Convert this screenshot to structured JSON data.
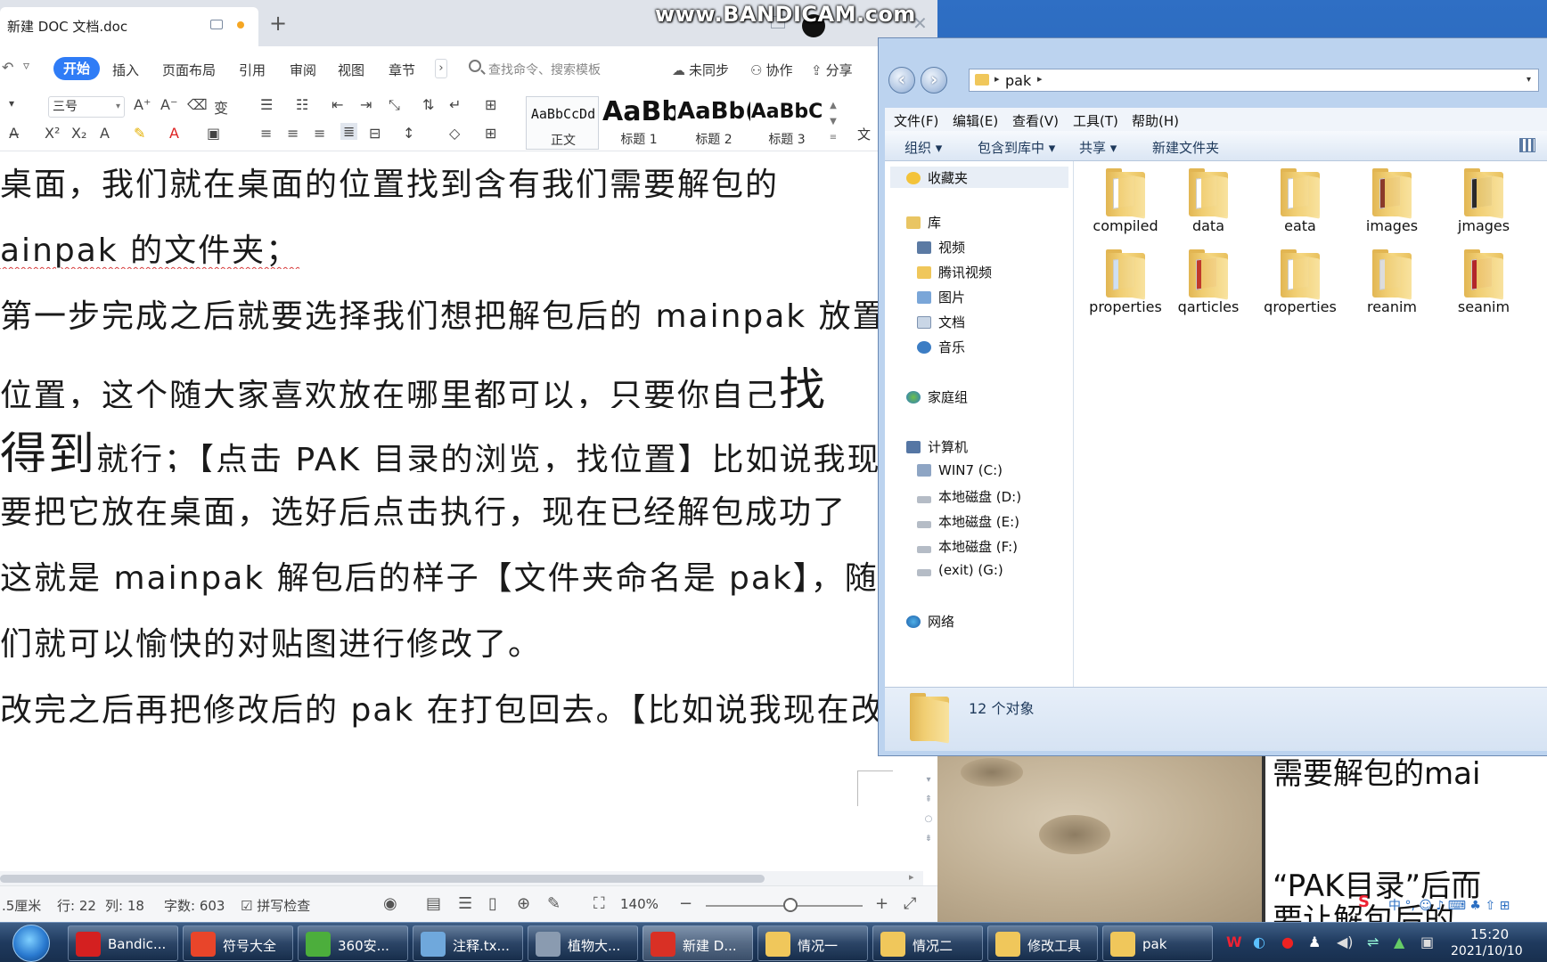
{
  "watermark": "www.BANDICAM.com",
  "wps": {
    "tab_title": "新建 DOC 文档.doc",
    "ribbon_tabs": [
      "开始",
      "插入",
      "页面布局",
      "引用",
      "审阅",
      "视图",
      "章节"
    ],
    "search_placeholder": "查找命令、搜索模板",
    "actions": {
      "sync": "未同步",
      "collab": "协作",
      "share": "分享"
    },
    "font_size": "三号",
    "styles": [
      {
        "preview": "AaBbCcDd",
        "name": "正文"
      },
      {
        "preview": "AaBb",
        "name": "标题 1"
      },
      {
        "preview": "AaBb(",
        "name": "标题 2"
      },
      {
        "preview": "AaBbC",
        "name": "标题 3"
      }
    ],
    "wen": "文",
    "doc_lines": [
      "桌面，我们就在桌面的位置找到含有我们需要解包的",
      "ainpak 的文件夹；",
      "第一步完成之后就要选择我们想把解包后的 mainpak 放置",
      "位置，这个随大家喜欢放在哪里都可以，只要你自己",
      "找",
      "得到",
      "就行；【点击 PAK 目录的浏览，找位置】比如说我现",
      "要把它放在桌面，选好后点击执行，现在已经解包成功了",
      "这就是 mainpak 解包后的样子【文件夹命名是 pak】，随后",
      "们就可以愉快的对贴图进行修改了。",
      "改完之后再把修改后的 pak 在打包回去。【比如说我现在改"
    ],
    "status": {
      "margin": ".5厘米",
      "row": "行: 22",
      "col": "列: 18",
      "words": "字数: 603",
      "spell": "拼写检查",
      "zoom": "140%"
    }
  },
  "explorer": {
    "path": "pak",
    "menu": [
      "文件(F)",
      "编辑(E)",
      "查看(V)",
      "工具(T)",
      "帮助(H)"
    ],
    "commands": [
      "组织 ▾",
      "包含到库中 ▾",
      "共享 ▾",
      "新建文件夹"
    ],
    "nav": {
      "favorites": "收藏夹",
      "libraries": "库",
      "lib_items": [
        "视频",
        "腾讯视频",
        "图片",
        "文档",
        "音乐"
      ],
      "homegroup": "家庭组",
      "computer": "计算机",
      "drives": [
        "WIN7 (C:)",
        "本地磁盘 (D:)",
        "本地磁盘 (E:)",
        "本地磁盘 (F:)",
        "(exit) (G:)"
      ],
      "network": "网络"
    },
    "items": [
      "compiled",
      "data",
      "eata",
      "images",
      "jmages",
      "properties",
      "qarticles",
      "qroperties",
      "reanim",
      "seanim"
    ],
    "count": "12 个对象"
  },
  "background_doc": {
    "line1": "需要解包的mai",
    "line2": "“PAK目录”后而",
    "line3": "要让解包后的"
  },
  "taskbar": {
    "buttons": [
      {
        "label": "Bandic...",
        "color": "#d42020"
      },
      {
        "label": "符号大全",
        "color": "#e8452a"
      },
      {
        "label": "360安...",
        "color": "#4cae3c"
      },
      {
        "label": "注释.tx...",
        "color": "#6fa8dc"
      },
      {
        "label": "植物大...",
        "color": "#8a9bb0"
      },
      {
        "label": "新建 D...",
        "color": "#d93025"
      },
      {
        "label": "情况一",
        "color": "#f0c75b"
      },
      {
        "label": "情况二",
        "color": "#f0c75b"
      },
      {
        "label": "修改工具",
        "color": "#f0c75b"
      },
      {
        "label": "pak",
        "color": "#f0c75b"
      }
    ],
    "time": "15:20",
    "date": "2021/10/10"
  }
}
